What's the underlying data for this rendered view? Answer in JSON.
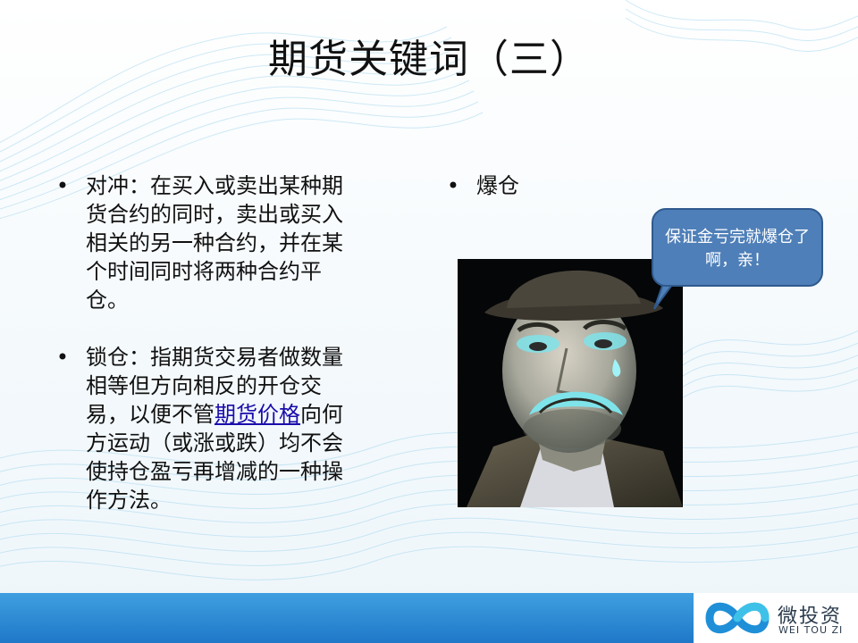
{
  "slide": {
    "title": "期货关键词（三）",
    "left_bullets": [
      {
        "marker": "•",
        "text": "对冲：在买入或卖出某种期货合约的同时，卖出或买入相关的另一种合约，并在某个时间同时将两种合约平仓。"
      },
      {
        "marker": "•",
        "text_before": "锁仓：指期货交易者做数量相等但方向相反的开仓交易，以便不管",
        "link": "期货价格",
        "text_after": "向何方运动（或涨或跌）均不会使持仓盈亏再增减的一种操作方法。"
      }
    ],
    "right_bullet": {
      "marker": "•",
      "text": "爆仓"
    },
    "speech_bubble": {
      "text": "保证金亏完就爆仓了啊，亲！"
    }
  },
  "footer": {
    "logo_cn": "微投资",
    "logo_en": "WEI TOU ZI"
  },
  "colors": {
    "footer_bar": "#2a8ad6",
    "bubble_fill": "#4f7fb8",
    "link": "#1a0dab"
  }
}
